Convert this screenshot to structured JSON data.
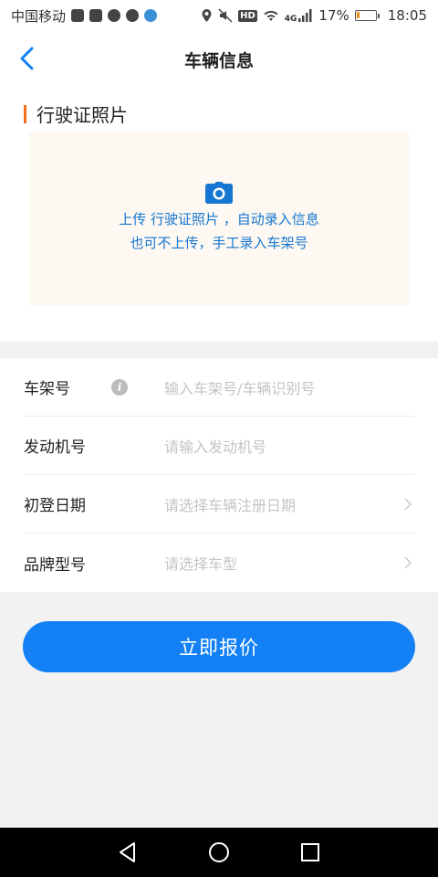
{
  "status_bar": {
    "carrier": "中国移动",
    "battery_percent": "17%",
    "battery_level": 0.17,
    "time": "18:05",
    "network": "4G",
    "hd": "HD"
  },
  "header": {
    "title": "车辆信息"
  },
  "upload": {
    "section_title": "行驶证照片",
    "line1": "上传 行驶证照片 ，自动录入信息",
    "line2": "也可不上传，手工录入车架号"
  },
  "form": {
    "rows": [
      {
        "label": "车架号",
        "placeholder": "输入车架号/车辆识别号"
      },
      {
        "label": "发动机号",
        "placeholder": "请输入发动机号"
      },
      {
        "label": "初登日期",
        "placeholder": "请选择车辆注册日期"
      },
      {
        "label": "品牌型号",
        "placeholder": "请选择车型"
      }
    ]
  },
  "submit_label": "立即报价",
  "colors": {
    "accent": "#1381f5",
    "section_bar": "#f0701e",
    "upload_bg": "#fdf8f1"
  }
}
